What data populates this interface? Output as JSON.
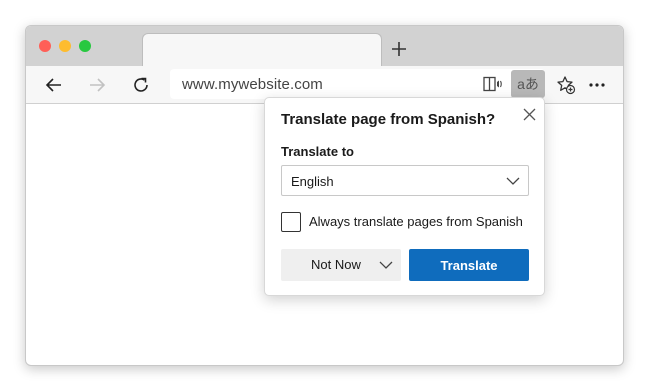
{
  "browser": {
    "address_url": "www.mywebsite.com",
    "translate_glyph": "aあ",
    "colors": {
      "titlebar": "#d2d2d2",
      "toolbar": "#f7f7f7",
      "accent": "#0f6cbd",
      "traffic_red": "#ff5f57",
      "traffic_yellow": "#febc2e",
      "traffic_green": "#28c840"
    },
    "icons": [
      "back-arrow-icon",
      "forward-arrow-icon",
      "refresh-icon",
      "new-tab-plus-icon",
      "reader-mode-icon",
      "translate-icon",
      "favorite-add-icon",
      "more-dots-icon"
    ]
  },
  "translate_popup": {
    "title": "Translate page from Spanish?",
    "translate_to_label": "Translate to",
    "selected_language": "English",
    "always_translate_label": "Always translate pages from Spanish",
    "always_translate_checked": false,
    "not_now_label": "Not Now",
    "translate_label": "Translate"
  }
}
